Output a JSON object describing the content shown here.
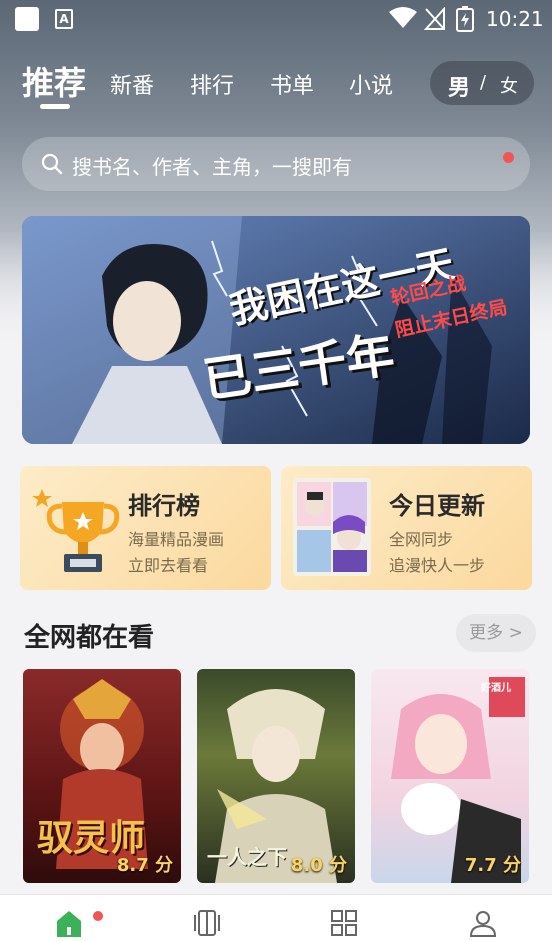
{
  "status_bar": {
    "time": "10:21",
    "icons": [
      "app-square-icon",
      "text-a-icon",
      "wifi-icon",
      "no-signal-icon",
      "battery-charging-icon"
    ]
  },
  "top_nav": {
    "tabs": [
      {
        "label": "推荐",
        "active": true
      },
      {
        "label": "新番",
        "active": false
      },
      {
        "label": "排行",
        "active": false
      },
      {
        "label": "书单",
        "active": false
      },
      {
        "label": "小说",
        "active": false
      }
    ],
    "gender": {
      "male": "男",
      "sep": "/",
      "female": "女"
    }
  },
  "search": {
    "placeholder": "搜书名、作者、主角，一搜即有"
  },
  "banner": {
    "title_line1": "我困在这一天",
    "title_line2": "已三千年",
    "subtitle_line1": "轮回之战",
    "subtitle_line2": "阻止末日终局"
  },
  "feature_cards": [
    {
      "title": "排行榜",
      "line1": "海量精品漫画",
      "line2": "立即去看看",
      "icon": "trophy-icon"
    },
    {
      "title": "今日更新",
      "line1": "全网同步",
      "line2": "追漫快人一步",
      "icon": "comic-thumbnail"
    }
  ],
  "section": {
    "title": "全网都在看",
    "more": "更多 >"
  },
  "books": [
    {
      "title_art": "驭灵师",
      "score": "8.7 分"
    },
    {
      "title_art": "一人之下",
      "score": "8.0 分"
    },
    {
      "title_art": "好酒儿",
      "score": "7.7 分"
    }
  ],
  "bottom_nav": {
    "items": [
      "home-icon",
      "library-icon",
      "category-icon",
      "profile-icon"
    ]
  },
  "colors": {
    "accent_green": "#3bb15a",
    "badge_red": "#f25454",
    "score_gold": "#fcd464",
    "card_bg": "#fbd99e"
  }
}
